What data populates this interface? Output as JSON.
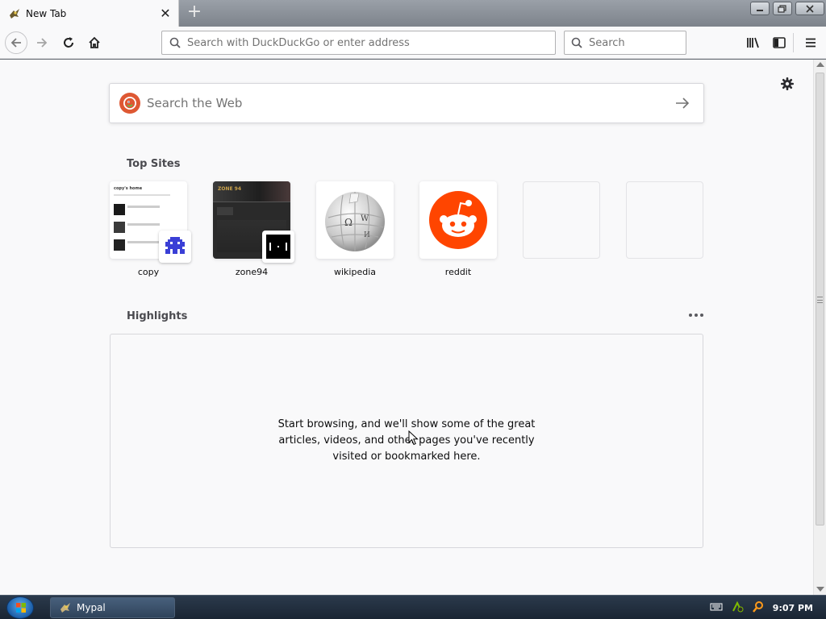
{
  "tabs": [
    {
      "title": "New Tab",
      "active": true
    }
  ],
  "toolbar": {
    "url_placeholder": "Search with DuckDuckGo or enter address",
    "search_placeholder": "Search"
  },
  "newtab": {
    "web_search_placeholder": "Search the Web",
    "top_sites_title": "Top Sites",
    "top_sites": [
      {
        "label": "copy"
      },
      {
        "label": "zone94"
      },
      {
        "label": "wikipedia"
      },
      {
        "label": "reddit"
      },
      {
        "label": ""
      },
      {
        "label": ""
      }
    ],
    "highlights_title": "Highlights",
    "highlights_empty_text": "Start browsing, and we'll show some of the great articles, videos, and other pages you've recently visited or bookmarked here."
  },
  "copy_thumb": {
    "heading": "copy's home"
  },
  "zone_thumb": {
    "text": "ZONE 94"
  },
  "taskbar": {
    "task_label": "Mypal",
    "clock": "9:07 PM"
  },
  "colors": {
    "ddg": "#de5833",
    "reddit": "#ff4500",
    "page_bg": "#f9f9fa"
  }
}
